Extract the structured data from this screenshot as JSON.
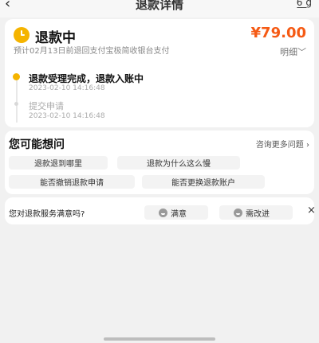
{
  "header": {
    "back_icon": "‹",
    "title": "退款详情",
    "share_icon": "6̲_g"
  },
  "status": {
    "title": "退款中",
    "amount": "¥79.00",
    "description": "预计02月13日前退回支付宝极简收银台支付",
    "detail_label": "明细",
    "timeline": [
      {
        "text": "退款受理完成，退款入账中",
        "time": "2023-02-10 14:16:48"
      },
      {
        "text": "提交申请",
        "time": "2023-02-10 14:16:48"
      }
    ]
  },
  "faq": {
    "title": "您可能想问",
    "more_label": "咨询更多问题",
    "questions": [
      "退款退到哪里",
      "退款为什么这么慢",
      "能否撤销退款申请",
      "能否更换退款账户"
    ]
  },
  "satisfaction": {
    "question": "您对退款服务满意吗?",
    "options": [
      "满意",
      "需改进"
    ]
  },
  "colors": {
    "accent": "#f5b400",
    "amount": "#f55a14"
  },
  "icons": [
    "back-icon",
    "share-icon",
    "clock-icon",
    "chevron-down-icon",
    "chevron-right-icon",
    "smile-icon",
    "close-icon"
  ]
}
